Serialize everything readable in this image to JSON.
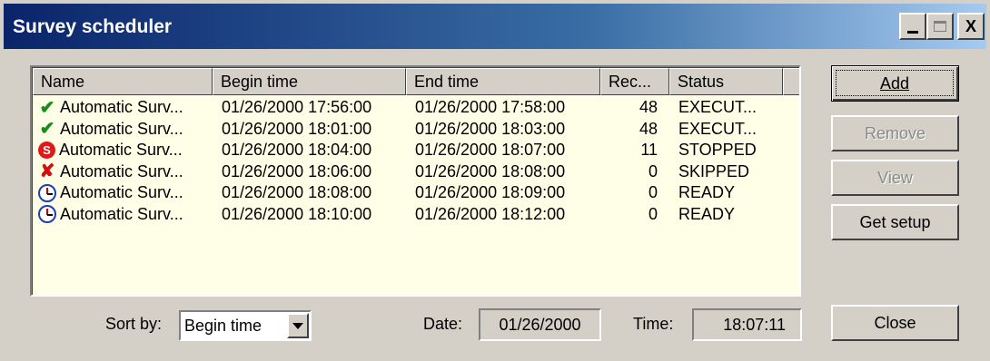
{
  "window": {
    "title": "Survey scheduler",
    "controls": [
      "minimize",
      "maximize",
      "close"
    ],
    "close_glyph": "X"
  },
  "list": {
    "columns": [
      "Name",
      "Begin time",
      "End time",
      "Rec...",
      "Status"
    ],
    "rows": [
      {
        "icon": "checkmark-icon",
        "name": "Automatic Surv...",
        "begin": "01/26/2000 17:56:00",
        "end": "01/26/2000 17:58:00",
        "rec": "48",
        "status": "EXECUT..."
      },
      {
        "icon": "checkmark-icon",
        "name": "Automatic Surv...",
        "begin": "01/26/2000 18:01:00",
        "end": "01/26/2000 18:03:00",
        "rec": "48",
        "status": "EXECUT..."
      },
      {
        "icon": "stop-icon",
        "name": "Automatic Surv...",
        "begin": "01/26/2000 18:04:00",
        "end": "01/26/2000 18:07:00",
        "rec": "11",
        "status": "STOPPED"
      },
      {
        "icon": "cross-icon",
        "name": "Automatic Surv...",
        "begin": "01/26/2000 18:06:00",
        "end": "01/26/2000 18:08:00",
        "rec": "0",
        "status": "SKIPPED"
      },
      {
        "icon": "clock-icon",
        "name": "Automatic Surv...",
        "begin": "01/26/2000 18:08:00",
        "end": "01/26/2000 18:09:00",
        "rec": "0",
        "status": "READY"
      },
      {
        "icon": "clock-icon",
        "name": "Automatic Surv...",
        "begin": "01/26/2000 18:10:00",
        "end": "01/26/2000 18:12:00",
        "rec": "0",
        "status": "READY"
      }
    ]
  },
  "buttons": {
    "add": "Add",
    "remove": "Remove",
    "view": "View",
    "get_setup": "Get setup",
    "close": "Close"
  },
  "footer": {
    "sort_label": "Sort by:",
    "sort_value": "Begin time",
    "date_label": "Date:",
    "date_value": "01/26/2000",
    "time_label": "Time:",
    "time_value": "18:07:11"
  },
  "colors": {
    "list_background": "#ffffe8",
    "title_gradient_start": "#0a246a",
    "title_gradient_end": "#a6caf0"
  }
}
